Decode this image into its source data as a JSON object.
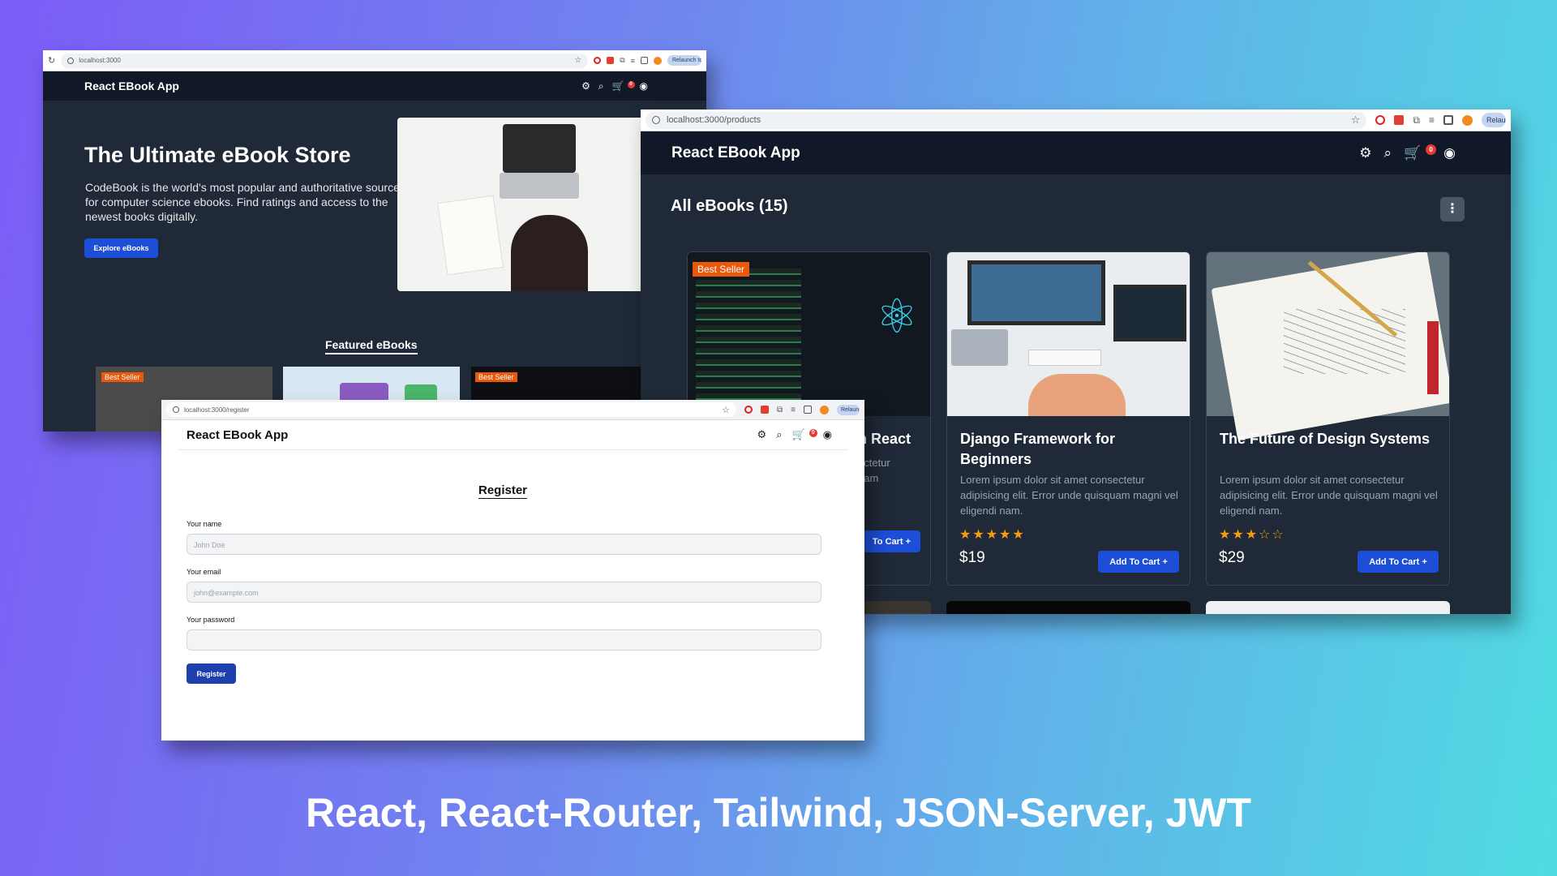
{
  "colors": {
    "accent": "#1d4ed8",
    "dark_bg": "#1f2937",
    "nav_bg": "#111827",
    "seller_tag": "#ea580c",
    "star": "#f59e0b"
  },
  "window_home": {
    "url": "localhost:3000",
    "relaunch": "Relaunch to",
    "brand": "React EBook App",
    "hero_title": "The Ultimate eBook Store",
    "hero_text": "CodeBook is the world's most popular and authoritative source for computer science ebooks. Find ratings and access to the newest books digitally.",
    "cta": "Explore eBooks",
    "featured_title": "Featured eBooks",
    "featured_tags": [
      "Best Seller",
      "Best Seller"
    ],
    "cart_count": "0",
    "icons": [
      "gear-icon",
      "search-icon",
      "cart-icon",
      "user-icon"
    ]
  },
  "window_products": {
    "url": "localhost:3000/products",
    "relaunch": "Relau",
    "brand": "React EBook App",
    "heading": "All eBooks (15)",
    "cart_count": "0",
    "cards": [
      {
        "tag": "Best Seller",
        "title_visible": "n React",
        "desc_visible": "ectetur\nuam",
        "button": "To Cart +"
      },
      {
        "title": "Django Framework for Beginners",
        "desc": "Lorem ipsum dolor sit amet consectetur adipisicing elit. Error unde quisquam magni vel eligendi nam.",
        "rating": 5,
        "stars": "★★★★★",
        "price": "$19",
        "button": "Add To Cart +"
      },
      {
        "title": "The Future of Design Systems",
        "desc": "Lorem ipsum dolor sit amet consectetur adipisicing elit. Error unde quisquam magni vel eligendi nam.",
        "rating": 3,
        "stars": "★★★☆☆",
        "price": "$29",
        "button": "Add To Cart +"
      }
    ]
  },
  "window_register": {
    "url": "localhost:3000/register",
    "relaunch": "Relaun",
    "brand": "React EBook App",
    "cart_count": "0",
    "heading": "Register",
    "name_label": "Your name",
    "name_placeholder": "John Doe",
    "email_label": "Your email",
    "email_placeholder": "john@example.com",
    "password_label": "Your password",
    "submit": "Register"
  },
  "caption": "React, React-Router, Tailwind, JSON-Server, JWT"
}
